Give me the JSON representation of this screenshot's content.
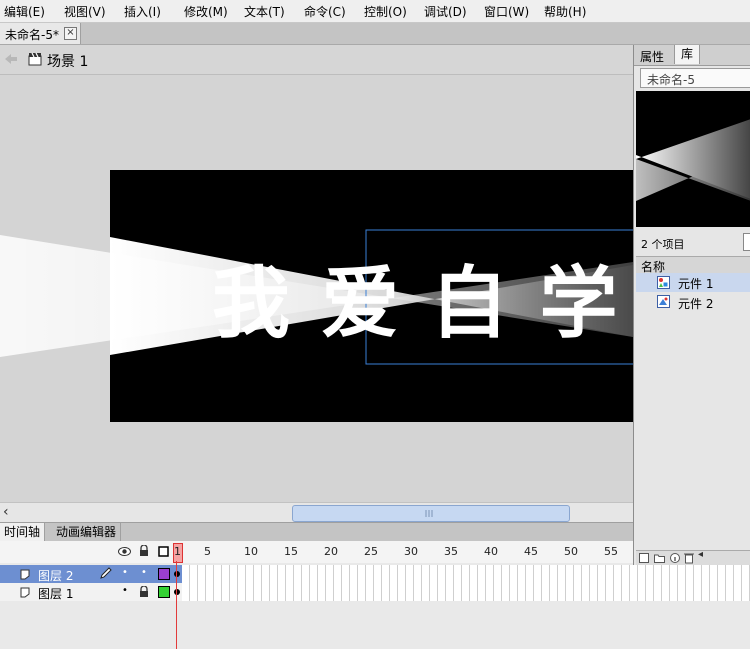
{
  "menu": [
    "编辑(E)",
    "视图(V)",
    "插入(I)",
    "修改(M)",
    "文本(T)",
    "命令(C)",
    "控制(O)",
    "调试(D)",
    "窗口(W)",
    "帮助(H)"
  ],
  "document_tab": {
    "title": "未命名-5*",
    "close_glyph": "×"
  },
  "scene": {
    "label": "场景 1"
  },
  "stage": {
    "text": "我 爱 自 学"
  },
  "timeline_tabs": [
    "时间轴",
    "动画编辑器"
  ],
  "timeline": {
    "frame_numbers": [
      "1",
      "5",
      "10",
      "15",
      "20",
      "25",
      "30",
      "35",
      "40",
      "45",
      "50",
      "55"
    ],
    "layers": [
      {
        "name": "图层 2",
        "color": "#9b3fcf",
        "selected": true
      },
      {
        "name": "图层 1",
        "color": "#33d133",
        "selected": false
      }
    ]
  },
  "panel": {
    "tabs": [
      "属性",
      "库"
    ],
    "library_dropdown": "未命名-5",
    "item_count": "2 个项目",
    "column_header": "名称",
    "items": [
      "元件 1",
      "元件 2"
    ]
  },
  "colors": {
    "accent_selected": "#6d8fd1",
    "playhead": "#e23b3b"
  }
}
